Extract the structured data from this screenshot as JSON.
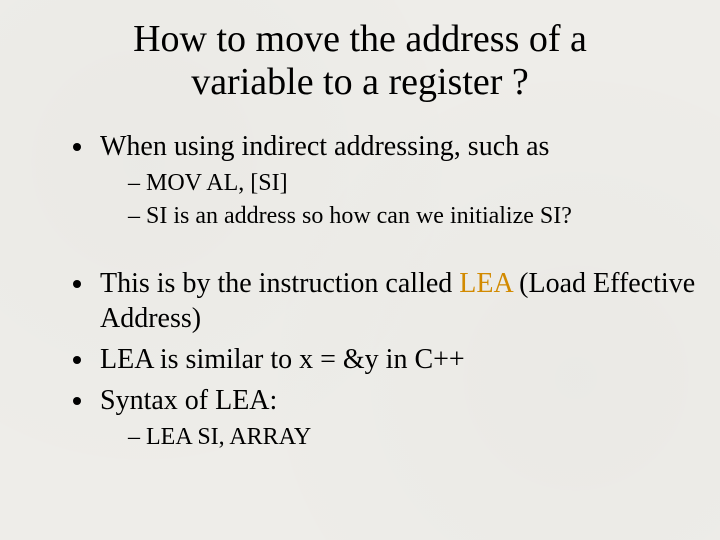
{
  "title_line1": "How to move the address of a",
  "title_line2": "variable to a register ?",
  "b1": "When using indirect addressing, such as",
  "b1_sub1": "MOV AL, [SI]",
  "b1_sub2": "SI is an address so how can we initialize SI?",
  "b2_pre": "This is by the instruction called ",
  "b2_hl": "LEA",
  "b2_post": " (Load Effective Address)",
  "b3": "LEA is similar to x = &y in C++",
  "b4": "Syntax of LEA:",
  "b4_sub1": "LEA SI, ARRAY"
}
